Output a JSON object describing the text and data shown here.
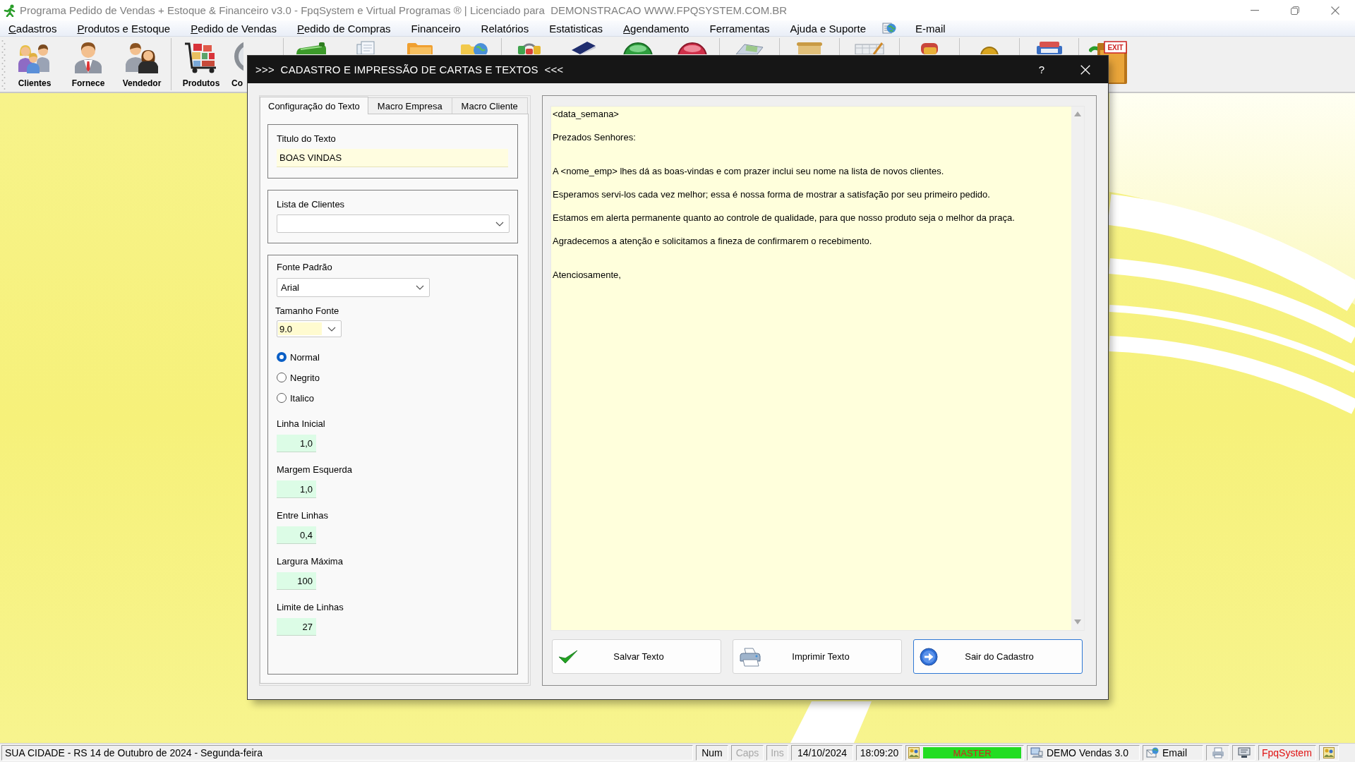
{
  "window": {
    "title": "Programa Pedido de Vendas + Estoque & Financeiro v3.0 - FpqSystem e Virtual Programas ® | Licenciado para  DEMONSTRACAO WWW.FPQSYSTEM.COM.BR"
  },
  "menu": [
    {
      "kind": "text",
      "label": "Cadastros",
      "mnemonic": true
    },
    {
      "kind": "text",
      "label": "Produtos e Estoque",
      "mnemonic": true
    },
    {
      "kind": "text",
      "label": "Pedido de Vendas",
      "mnemonic": true
    },
    {
      "kind": "text",
      "label": "Pedido de Compras",
      "mnemonic": true
    },
    {
      "kind": "text",
      "label": "Financeiro",
      "mnemonic": false
    },
    {
      "kind": "text",
      "label": "Relatórios",
      "mnemonic": false
    },
    {
      "kind": "text",
      "label": "Estatisticas",
      "mnemonic": false
    },
    {
      "kind": "text",
      "label": "Agendamento",
      "mnemonic": true
    },
    {
      "kind": "text",
      "label": "Ferramentas",
      "mnemonic": false
    },
    {
      "kind": "text",
      "label": "Ajuda e Suporte",
      "mnemonic": false
    },
    {
      "kind": "icon"
    },
    {
      "kind": "text",
      "label": "E-mail",
      "mnemonic": false
    }
  ],
  "toolbar": {
    "buttons": [
      {
        "label": "Clientes"
      },
      {
        "label": "Fornece"
      },
      {
        "label": "Vendedor"
      },
      {
        "label": "Produtos"
      },
      {
        "label": "Co"
      }
    ],
    "exit_sign": "EXIT"
  },
  "dialog": {
    "title": ">>>  CADASTRO E IMPRESSÃO DE CARTAS E TEXTOS  <<<",
    "help": "?",
    "tabs": [
      {
        "label": "Configuração do Texto",
        "selected": true
      },
      {
        "label": "Macro Empresa",
        "selected": false
      },
      {
        "label": "Macro Cliente",
        "selected": false
      }
    ],
    "title_group": {
      "label": "Titulo do Texto",
      "value": "BOAS VINDAS"
    },
    "clients_group": {
      "label": "Lista de Clientes"
    },
    "font_group": {
      "font_label": "Fonte Padrão",
      "font_value": "Arial",
      "size_label": "Tamanho Fonte",
      "size_value": "9.0",
      "styles": [
        {
          "label": "Normal",
          "selected": true
        },
        {
          "label": "Negrito",
          "selected": false
        },
        {
          "label": "Italico",
          "selected": false
        }
      ],
      "fields": [
        {
          "label": "Linha Inicial",
          "value": "1,0"
        },
        {
          "label": "Margem Esquerda",
          "value": "1,0"
        },
        {
          "label": "Entre Linhas",
          "value": "0,4"
        },
        {
          "label": "Largura Máxima",
          "value": "100"
        },
        {
          "label": "Limite de Linhas",
          "value": "27"
        }
      ]
    },
    "memo": {
      "paragraphs": [
        [
          "<data_semana>",
          "Prezados Senhores:"
        ],
        [
          "A <nome_emp> lhes dá as boas-vindas e com prazer inclui seu nome na lista de novos clientes.",
          "Esperamos servi-los cada vez melhor; essa é nossa forma de mostrar a satisfação por seu primeiro pedido.",
          "Estamos em alerta permanente quanto ao controle de qualidade, para que nosso produto seja o melhor da praça.",
          "Agradecemos a atenção e solicitamos a fineza de confirmarem o recebimento."
        ],
        [
          "Atenciosamente,"
        ]
      ]
    },
    "buttons": [
      {
        "label": "Salvar Texto",
        "focused": false
      },
      {
        "label": "Imprimir Texto",
        "focused": false
      },
      {
        "label": "Sair do Cadastro",
        "focused": true
      }
    ]
  },
  "status_bar": {
    "location": "SUA CIDADE - RS 14 de Outubro de 2024 - Segunda-feira",
    "indicators": [
      {
        "label": "Num",
        "on": true
      },
      {
        "label": "Caps",
        "on": false
      },
      {
        "label": "Ins",
        "on": false
      }
    ],
    "date": "14/10/2024",
    "time": "18:09:20",
    "user": "MASTER",
    "system": "DEMO Vendas 3.0",
    "email": "Email",
    "brand": "FpqSystem"
  }
}
